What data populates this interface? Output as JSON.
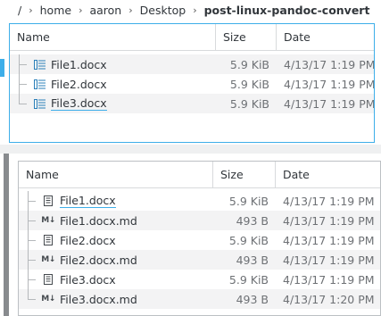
{
  "breadcrumb": {
    "items": [
      "/",
      "home",
      "aaron",
      "Desktop",
      "post-linux-pandoc-convert"
    ],
    "separator": "›"
  },
  "top_panel": {
    "columns": {
      "name": "Name",
      "size": "Size",
      "date": "Date"
    },
    "rows": [
      {
        "name": "File1.docx",
        "size": "5.9 KiB",
        "date": "4/13/17 1:19 PM",
        "icon": "docx-icon"
      },
      {
        "name": "File2.docx",
        "size": "5.9 KiB",
        "date": "4/13/17 1:19 PM",
        "icon": "docx-icon"
      },
      {
        "name": "File3.docx",
        "size": "5.9 KiB",
        "date": "4/13/17 1:19 PM",
        "icon": "docx-icon"
      }
    ]
  },
  "bottom_panel": {
    "columns": {
      "name": "Name",
      "size": "Size",
      "date": "Date"
    },
    "rows": [
      {
        "name": "File1.docx",
        "size": "5.9 KiB",
        "date": "4/13/17 1:19 PM",
        "icon": "document-icon"
      },
      {
        "name": "File1.docx.md",
        "size": "493 B",
        "date": "4/13/17 1:19 PM",
        "icon": "markdown-icon"
      },
      {
        "name": "File2.docx",
        "size": "5.9 KiB",
        "date": "4/13/17 1:19 PM",
        "icon": "document-icon"
      },
      {
        "name": "File2.docx.md",
        "size": "493 B",
        "date": "4/13/17 1:19 PM",
        "icon": "markdown-icon"
      },
      {
        "name": "File3.docx",
        "size": "5.9 KiB",
        "date": "4/13/17 1:19 PM",
        "icon": "document-icon"
      },
      {
        "name": "File3.docx.md",
        "size": "493 B",
        "date": "4/13/17 1:20 PM",
        "icon": "markdown-icon"
      }
    ]
  },
  "colors": {
    "accent": "#3daee9",
    "alt_row": "#f3f3f4",
    "muted_text": "#6e7175"
  }
}
